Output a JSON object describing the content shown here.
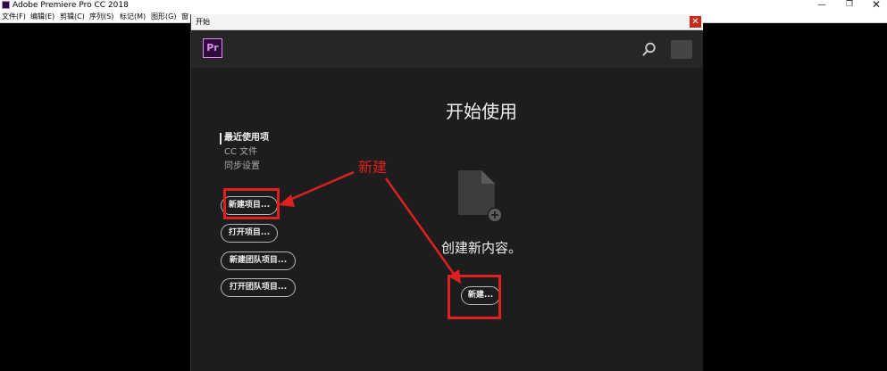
{
  "app": {
    "title": "Adobe Premiere Pro CC 2018"
  },
  "menubar": {
    "items": [
      "文件(F)",
      "编辑(E)",
      "剪辑(C)",
      "序列(S)",
      "标记(M)",
      "图形(G)",
      "窗"
    ]
  },
  "dialog": {
    "title": "开始",
    "logo_text": "Pr",
    "heading": "开始使用",
    "sidebar": {
      "links": [
        "最近使用项",
        "CC 文件",
        "同步设置"
      ],
      "active_index": 0
    },
    "buttons": [
      "新建项目...",
      "打开项目...",
      "新建团队项目...",
      "打开团队项目..."
    ],
    "create_text": "创建新内容。",
    "new_button": "新建..."
  },
  "annotation": {
    "label": "新建",
    "color": "#e02020"
  },
  "colors": {
    "accent_pr": "#e08cf2",
    "dialog_bg": "#1d1d1d",
    "header_bg": "#262626"
  }
}
